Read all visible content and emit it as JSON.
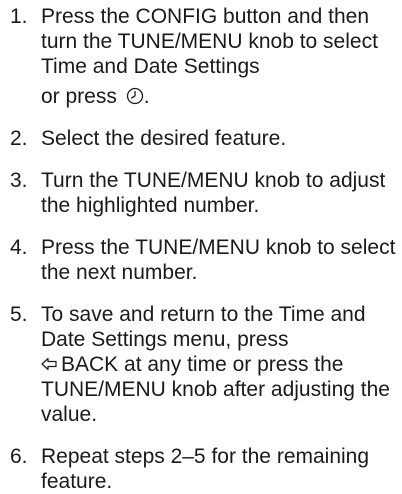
{
  "steps": [
    {
      "number": "1.",
      "text": "Press the CONFIG button and then turn the TUNE/MENU knob to select Time and Date Settings",
      "text_after": "or press",
      "text_end": ".",
      "icon": "clock-icon"
    },
    {
      "number": "2.",
      "text": "Select the desired feature."
    },
    {
      "number": "3.",
      "text": "Turn the TUNE/MENU knob to adjust the highlighted number."
    },
    {
      "number": "4.",
      "text": "Press the TUNE/MENU knob to select the next number."
    },
    {
      "number": "5.",
      "text": "To save and return to the Time and Date Settings menu, press",
      "back_label": "BACK",
      "back_icon": "back-arrow-icon",
      "text_after": "at any time or press the TUNE/MENU knob after adjusting the value."
    },
    {
      "number": "6.",
      "text": "Repeat steps 2–5 for the remaining feature."
    }
  ]
}
